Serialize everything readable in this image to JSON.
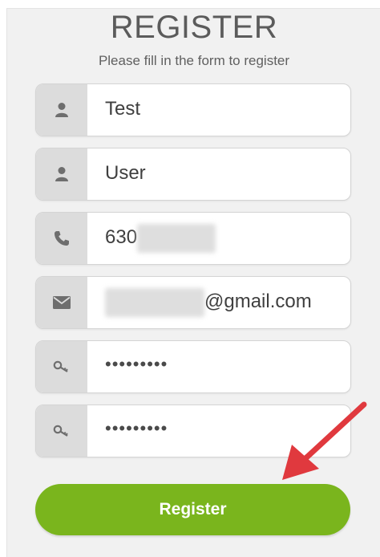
{
  "title": "REGISTER",
  "subtitle": "Please fill in the form to register",
  "fields": [
    {
      "name": "first-name-field",
      "icon": "user-icon",
      "value": "Test"
    },
    {
      "name": "last-name-field",
      "icon": "user-icon",
      "value": "User"
    },
    {
      "name": "phone-field",
      "icon": "phone-icon",
      "value": "630"
    },
    {
      "name": "email-field",
      "icon": "envelope-icon",
      "value": "@gmail.com"
    },
    {
      "name": "password-field",
      "icon": "key-icon",
      "value": "•••••••••"
    },
    {
      "name": "confirm-password-field",
      "icon": "key-icon",
      "value": "•••••••••"
    }
  ],
  "register_button": {
    "label": "Register"
  },
  "colors": {
    "accent": "#7ab51d",
    "annotation_arrow": "#e0393e",
    "icon_panel": "#dcdcdc",
    "icon": "#6e6e6e"
  }
}
